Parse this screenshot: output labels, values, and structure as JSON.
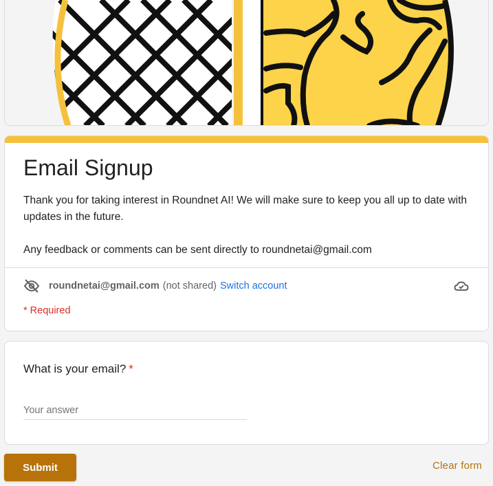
{
  "form": {
    "title": "Email Signup",
    "description_line1": "Thank you for taking interest in Roundnet AI! We will make sure to keep you all up to date with updates in the future.",
    "description_line2": "Any feedback or comments can be sent directly to roundnetai@gmail.com",
    "accent_color": "#f5c13d",
    "button_color": "#b7720a"
  },
  "account": {
    "email": "roundnetai@gmail.com",
    "not_shared": "(not shared)",
    "switch_label": "Switch account",
    "privacy_icon": "eye-off-icon",
    "save_icon": "cloud-check-icon"
  },
  "required_note": "* Required",
  "question": {
    "title": "What is your email?",
    "required_mark": "*",
    "placeholder": "Your answer"
  },
  "actions": {
    "submit_label": "Submit",
    "clear_label": "Clear form"
  }
}
